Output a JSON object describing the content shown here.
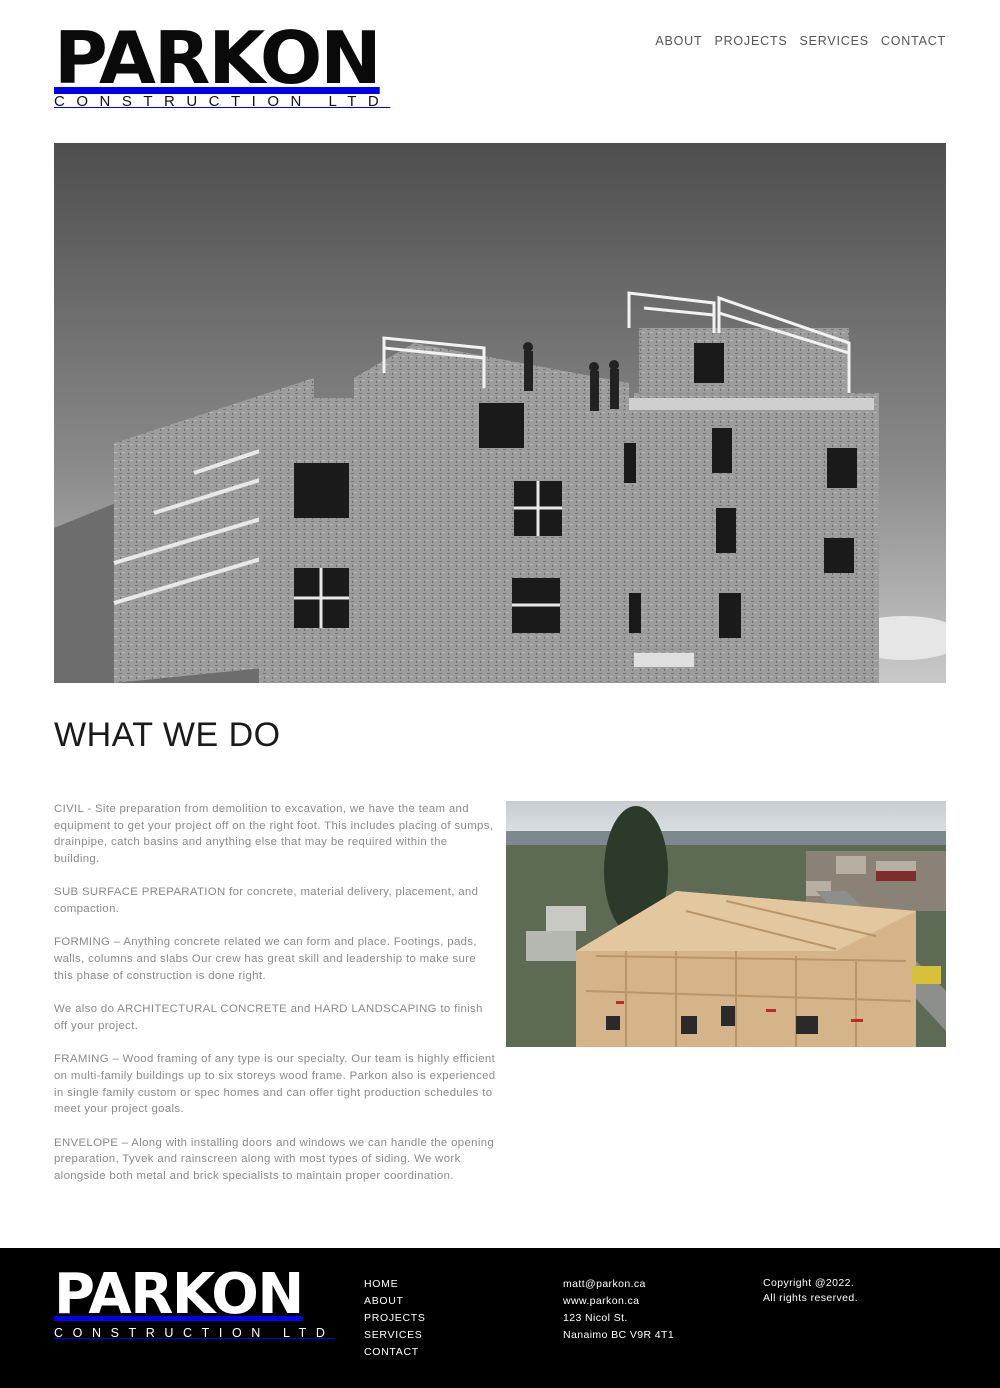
{
  "brand": {
    "name": "PARKON",
    "subtitle": "CONSTRUCTION LTD"
  },
  "nav": {
    "items": [
      "ABOUT",
      "PROJECTS",
      "SERVICES",
      "CONTACT"
    ]
  },
  "section": {
    "title": "WHAT WE DO",
    "paragraphs": [
      "CIVIL - Site preparation from demolition to excavation, we have the team and equipment to get your project off on the right foot. This includes placing of sumps, drainpipe, catch basins and anything else that may be required within the building.",
      "SUB SURFACE PREPARATION for concrete, material delivery, placement, and compaction.",
      "FORMING – Anything concrete related we can form and place. Footings, pads, walls, columns and slabs Our crew has great skill and leadership to make sure this phase of construction is done right.",
      "We also do ARCHITECTURAL CONCRETE and HARD LANDSCAPING to finish off your project.",
      "FRAMING – Wood framing of any type is our specialty. Our team is highly efficient on multi-family buildings up to six storeys wood frame. Parkon also is experienced in single family custom or spec homes and can offer tight production schedules to meet your project goals.",
      "ENVELOPE – Along with installing doors and windows we can handle the opening preparation, Tyvek and rainscreen along with most types of siding. We work alongside both metal and brick specialists to maintain proper coordination."
    ]
  },
  "footer": {
    "nav": [
      "HOME",
      "ABOUT",
      "PROJECTS",
      "SERVICES",
      "CONTACT"
    ],
    "email": "matt@parkon.ca",
    "website": "www.parkon.ca",
    "address_line1": "123 Nicol St.",
    "address_line2": "Nanaimo BC V9R 4T1",
    "copyright_line1": "Copyright @2022.",
    "copyright_line2": "All rights reserved."
  },
  "colors": {
    "footer_bg": "#000000",
    "text_muted": "#8a8a8a",
    "heading": "#1a1a1a"
  }
}
